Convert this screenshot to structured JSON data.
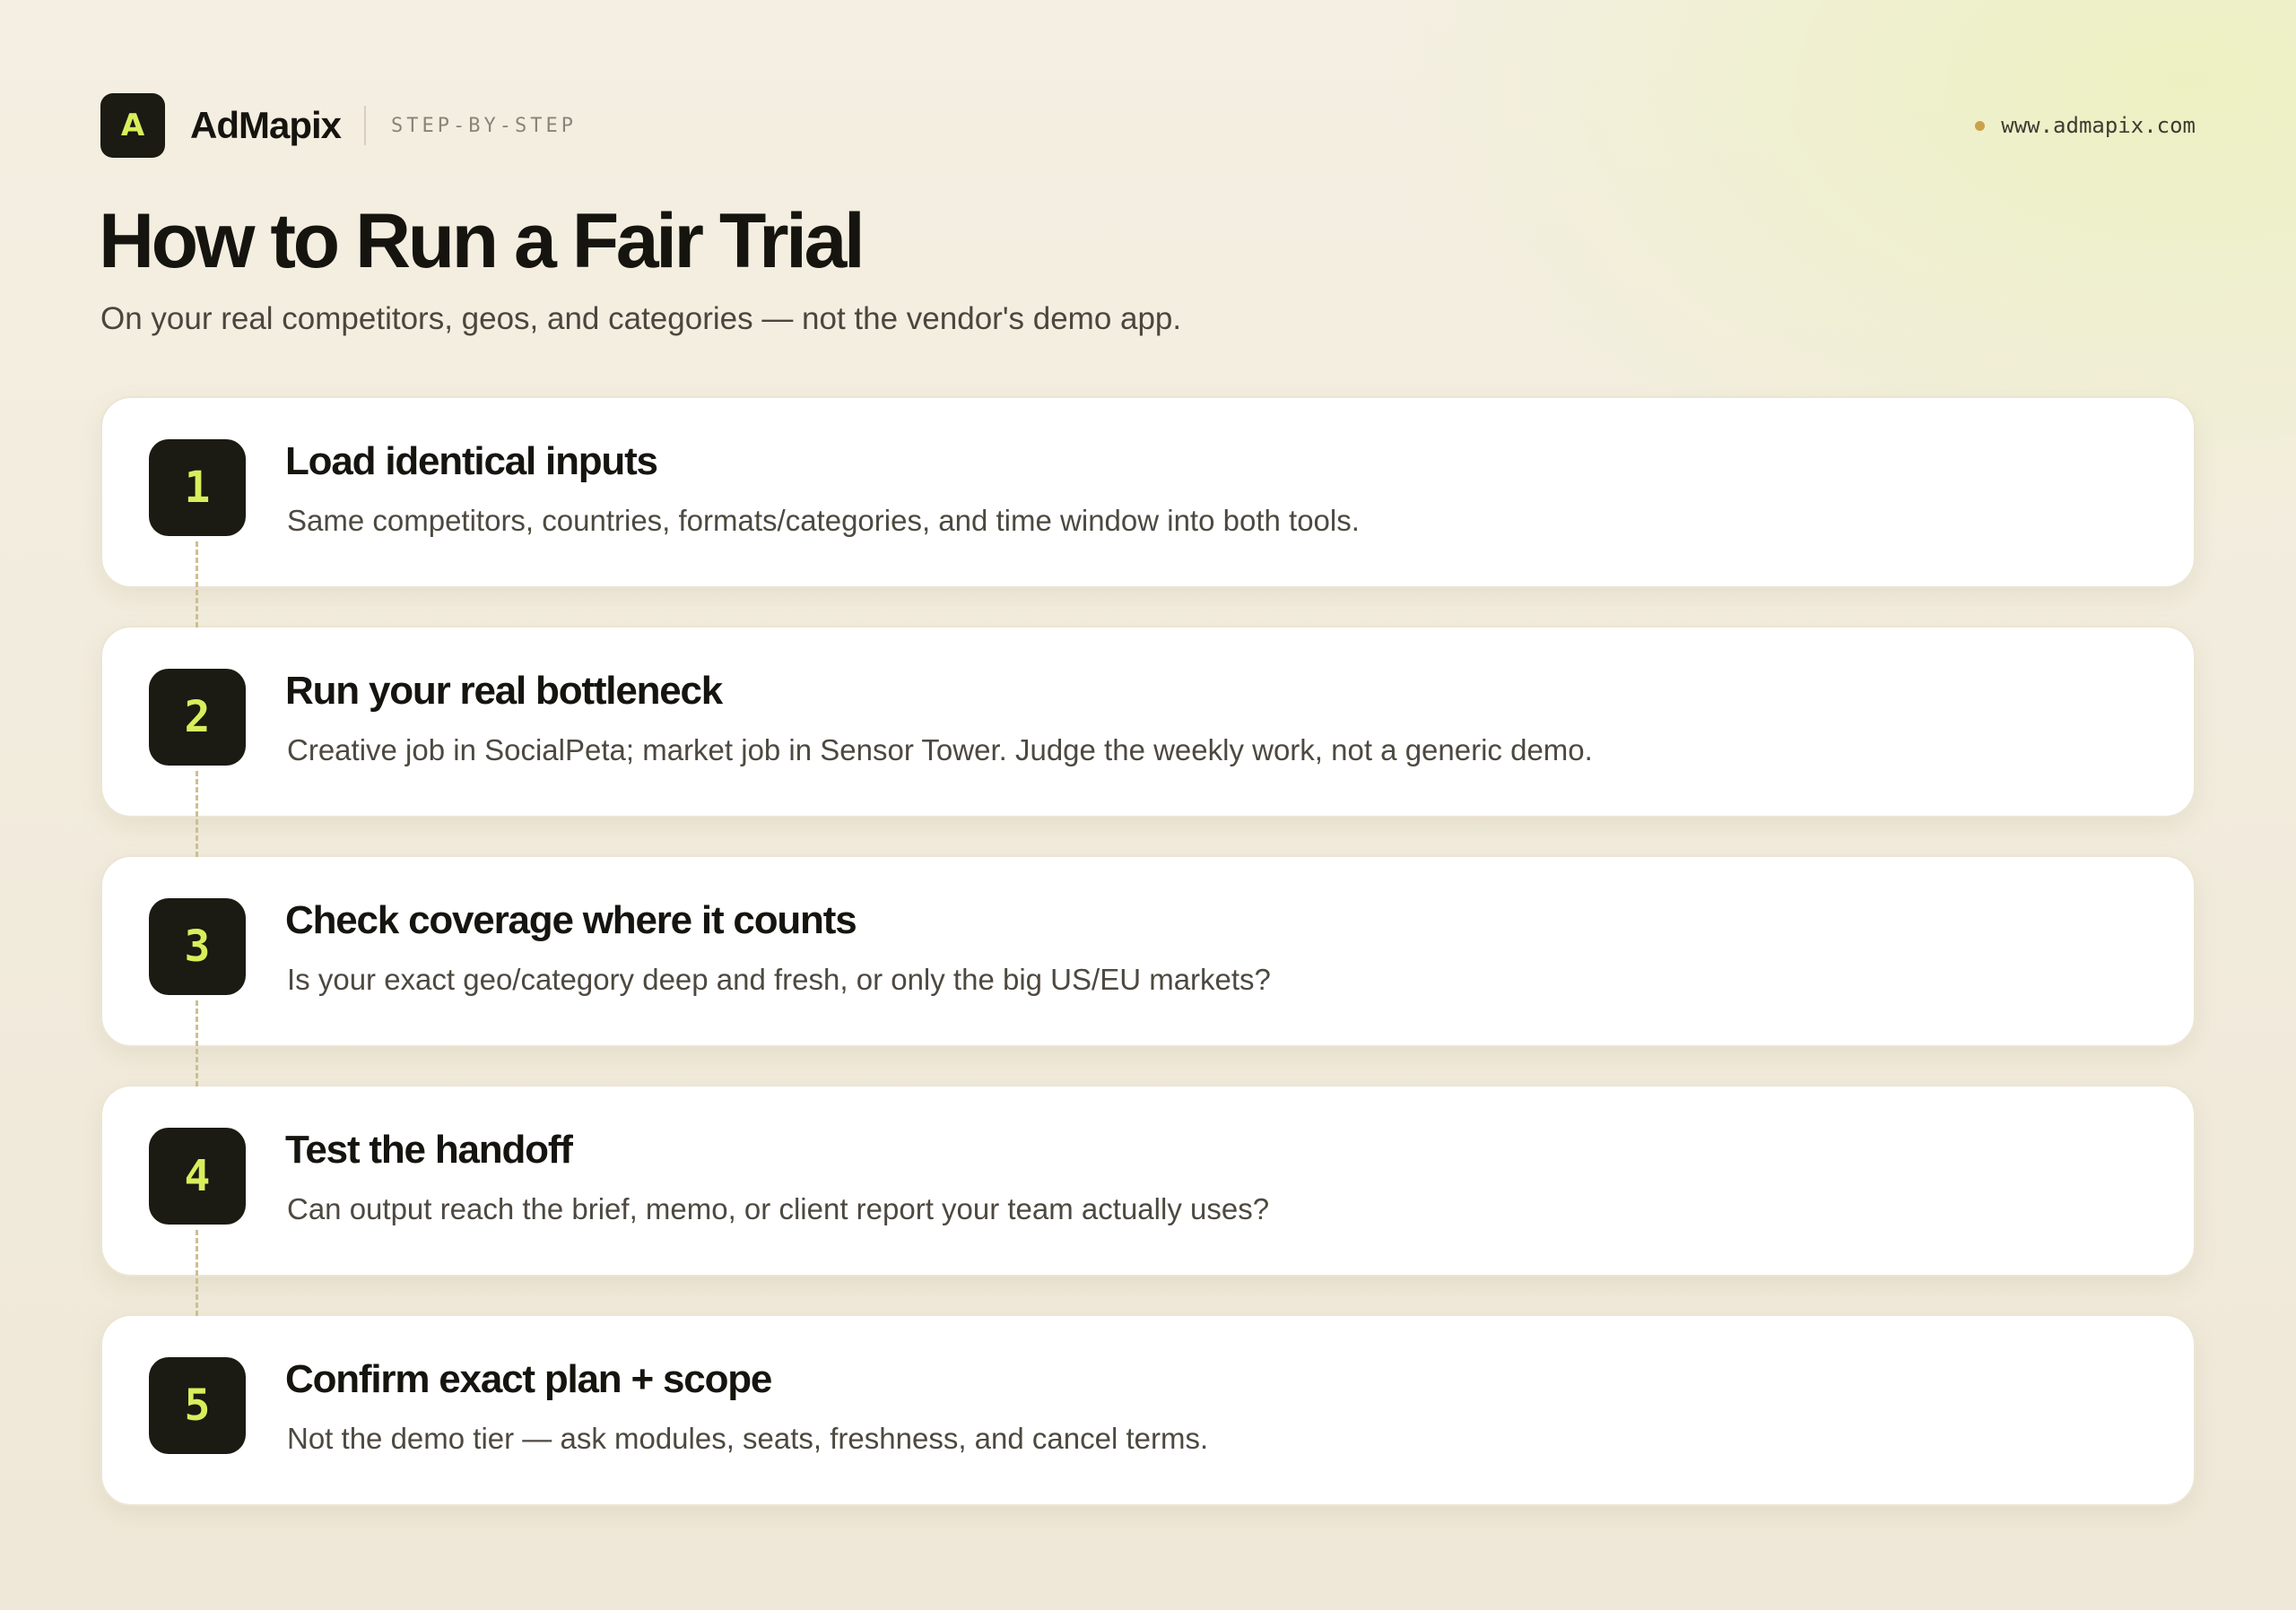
{
  "header": {
    "logo_letter": "A",
    "brand": "AdMapix",
    "eyebrow": "STEP-BY-STEP",
    "url": "www.admapix.com"
  },
  "title": "How to Run a Fair Trial",
  "subtitle": "On your real competitors, geos, and categories — not the vendor's demo app.",
  "colors": {
    "badge_bg": "#1b1a13",
    "badge_text": "#d8ef5c",
    "url_dot": "#c9a24a",
    "connector": "#cdbf8f"
  },
  "steps": [
    {
      "number": "1",
      "title": "Load identical inputs",
      "desc": "Same competitors, countries, formats/categories, and time window into both tools."
    },
    {
      "number": "2",
      "title": "Run your real bottleneck",
      "desc": "Creative job in SocialPeta; market job in Sensor Tower. Judge the weekly work, not a generic demo."
    },
    {
      "number": "3",
      "title": "Check coverage where it counts",
      "desc": "Is your exact geo/category deep and fresh, or only the big US/EU markets?"
    },
    {
      "number": "4",
      "title": "Test the handoff",
      "desc": "Can output reach the brief, memo, or client report your team actually uses?"
    },
    {
      "number": "5",
      "title": "Confirm exact plan + scope",
      "desc": "Not the demo tier — ask modules, seats, freshness, and cancel terms."
    }
  ]
}
